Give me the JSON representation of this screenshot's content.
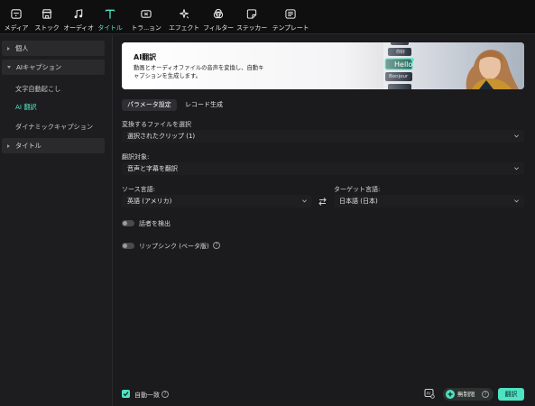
{
  "toolbar": {
    "items": [
      {
        "label": "メディア",
        "icon": "media-icon"
      },
      {
        "label": "ストック",
        "icon": "stock-icon"
      },
      {
        "label": "オーディオ",
        "icon": "music-note-icon"
      },
      {
        "label": "タイトル",
        "icon": "title-t-icon",
        "active": true
      },
      {
        "label": "トランジション",
        "display": "トラ...ョン",
        "icon": "transition-icon"
      },
      {
        "label": "エフェクト",
        "icon": "effect-sparkle-icon"
      },
      {
        "label": "フィルター",
        "icon": "filter-icon"
      },
      {
        "label": "ステッカー",
        "icon": "sticker-icon"
      },
      {
        "label": "テンプレート",
        "icon": "template-icon"
      }
    ]
  },
  "sidebar": {
    "categories": [
      {
        "label": "個人",
        "expanded": false
      },
      {
        "label": "AIキャプション",
        "expanded": true
      },
      {
        "label": "タイトル",
        "expanded": false
      }
    ],
    "subitems": [
      {
        "label": "文字自動起こし",
        "active": false
      },
      {
        "label": "AI 翻訳",
        "active": true
      },
      {
        "label": "ダイナミックキャプション",
        "active": false
      }
    ]
  },
  "banner": {
    "title": "AI翻訳",
    "description": "動画とオーディオファイルの音声を変換し、自動キャプションを生成します。",
    "bubbles": [
      "你好",
      "Hello",
      "Bonjour"
    ]
  },
  "tabs": [
    {
      "label": "パラメータ設定",
      "active": true
    },
    {
      "label": "レコード生成",
      "active": false
    }
  ],
  "form": {
    "file_label": "変換するファイルを選択",
    "file_value": "選択されたクリップ (1)",
    "target_label": "翻訳対象:",
    "target_value": "音声と字幕を翻訳",
    "source_lang_label": "ソース言語:",
    "source_lang_value": "英語 (アメリカ)",
    "target_lang_label": "ターゲット言語:",
    "target_lang_value": "日本語 (日本)",
    "speaker_label": "話者を検出",
    "lipsync_label": "リップシンク (ベータ版)"
  },
  "footer": {
    "auto_match_label": "自動一致",
    "auto_match_checked": true,
    "unlimited_label": "無制限",
    "translate_button": "翻訳"
  },
  "colors": {
    "accent": "#4fe3c3",
    "background": "#1b1b1d"
  }
}
